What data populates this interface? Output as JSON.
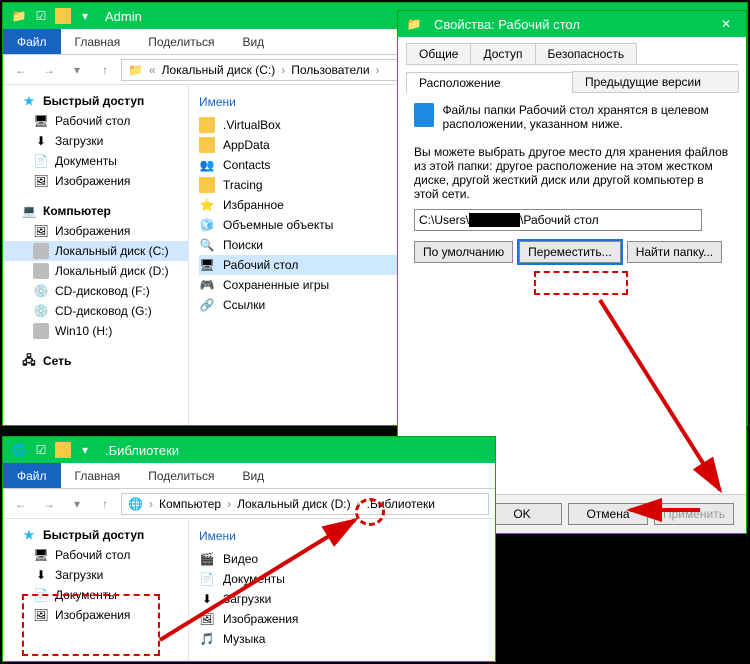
{
  "win1": {
    "title": "Admin",
    "tabs": {
      "file": "Файл",
      "home": "Главная",
      "share": "Поделиться",
      "view": "Вид"
    },
    "path": [
      "Локальный диск (C:)",
      "Пользователи"
    ],
    "nav": {
      "quick": "Быстрый доступ",
      "quick_items": [
        "Рабочий стол",
        "Загрузки",
        "Документы",
        "Изображения"
      ],
      "computer": "Компьютер",
      "computer_items": [
        "Изображения",
        "Локальный диск (C:)",
        "Локальный диск (D:)",
        "CD-дисковод (F:)",
        "CD-дисковод (G:)",
        "Win10 (H:)"
      ],
      "network": "Сеть"
    },
    "content_header": "Имени",
    "items": [
      ".VirtualBox",
      "AppData",
      "Contacts",
      "Tracing",
      "Избранное",
      "Объемные объекты",
      "Поиски",
      "Рабочий стол",
      "Сохраненные игры",
      "Ссылки"
    ],
    "selected_nav": "Локальный диск (C:)",
    "selected_item": "Рабочий стол"
  },
  "win2": {
    "title": ".Библиотеки",
    "tabs": {
      "file": "Файл",
      "home": "Главная",
      "share": "Поделиться",
      "view": "Вид"
    },
    "path": [
      "Компьютер",
      "Локальный диск (D:)",
      ".Библиотеки"
    ],
    "nav": {
      "quick": "Быстрый доступ",
      "quick_items": [
        "Рабочий стол",
        "Загрузки",
        "Документы",
        "Изображения"
      ]
    },
    "content_header": "Имени",
    "items": [
      "Видео",
      "Документы",
      "Загрузки",
      "Изображения",
      "Музыка"
    ]
  },
  "props": {
    "title": "Свойства: Рабочий стол",
    "tabs_row1": [
      "Общие",
      "Доступ",
      "Безопасность"
    ],
    "tabs_row2": [
      "Расположение",
      "Предыдущие версии"
    ],
    "active_tab": "Расположение",
    "desc1": "Файлы папки Рабочий стол хранятся в целевом расположении, указанном ниже.",
    "desc2": "Вы можете выбрать другое место для хранения файлов из этой папки: другое расположение на этом жестком диске, другой жесткий диск или другой компьютер в этой сети.",
    "path_value": "C:\\Users\\██████\\Рабочий стол",
    "buttons": {
      "default": "По умолчанию",
      "move": "Переместить...",
      "find": "Найти папку..."
    },
    "footer": {
      "ok": "OK",
      "cancel": "Отмена",
      "apply": "Применить"
    }
  }
}
